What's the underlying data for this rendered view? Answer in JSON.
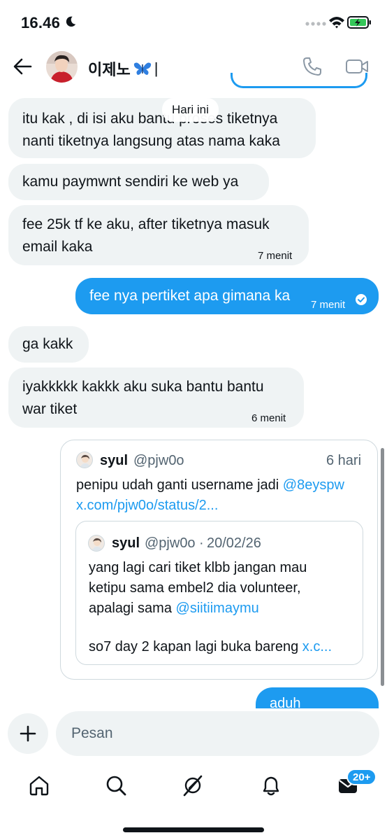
{
  "status_bar": {
    "time": "16.46"
  },
  "header": {
    "contact_name": "이제노",
    "name_suffix": "|",
    "icons": [
      "back-arrow-icon",
      "phone-icon",
      "video-camera-icon"
    ]
  },
  "date_separator": "Hari ini",
  "messages": [
    {
      "direction": "in",
      "lines": [
        "itu kak , di isi aku bantu proses tiketnya",
        "nanti tiketnya langsung atas nama kaka"
      ],
      "time": ""
    },
    {
      "direction": "in",
      "lines": [
        "kamu paymwnt sendiri ke web ya"
      ],
      "time": ""
    },
    {
      "direction": "in",
      "lines": [
        "fee 25k tf ke aku, after tiketnya masuk",
        "email kaka"
      ],
      "time": "7 menit"
    },
    {
      "direction": "out",
      "lines": [
        "fee nya pertiket apa gimana ka"
      ],
      "time": "7 menit"
    },
    {
      "direction": "in",
      "lines": [
        "ga kakk"
      ],
      "time": ""
    },
    {
      "direction": "in",
      "lines": [
        "iyakkkkk kakkk aku suka bantu bantu",
        "war tiket"
      ],
      "time": "6 menit"
    }
  ],
  "quote": {
    "name": "syul",
    "handle": "@pjw0o",
    "age": "6 hari",
    "text_before": "penipu udah ganti username jadi ",
    "mention": "@8eyspw",
    "url": "x.com/pjw0o/status/2...",
    "inner": {
      "name": "syul",
      "handle": "@pjw0o",
      "date": "20/02/26",
      "line1": "yang lagi cari tiket klbb jangan mau",
      "line2": "ketipu sama embel2 dia volunteer,",
      "line3_before": "apalagi sama ",
      "line3_mention": "@siitiimaymu",
      "line4_before": "so7 day 2 kapan lagi buka bareng ",
      "line4_link": "x.c..."
    }
  },
  "next_outgoing_partial": "aduh",
  "composer": {
    "placeholder": "Pesan"
  },
  "nav": {
    "items": [
      "home-icon",
      "search-icon",
      "grok-icon",
      "notifications-icon",
      "messages-icon"
    ],
    "messages_badge": "20+"
  },
  "colors": {
    "accent": "#1d9bf0",
    "bubble_in": "#eff3f4",
    "text": "#0f1419",
    "secondary_text": "#536471"
  }
}
